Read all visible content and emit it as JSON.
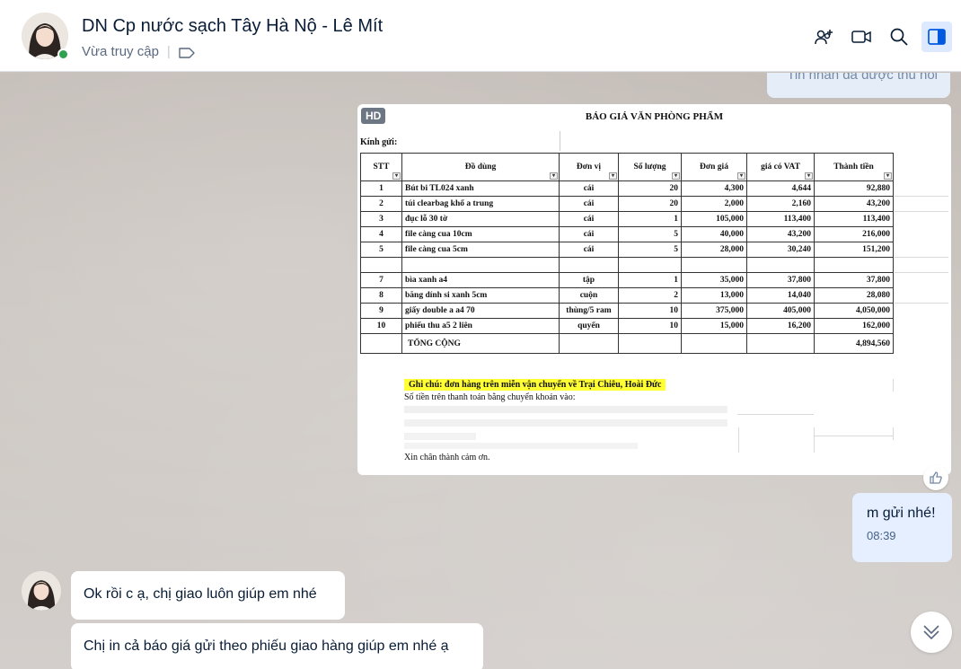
{
  "header": {
    "title": "DN Cp nước sạch Tây Hà Nộ - Lê Mít",
    "status": "Vừa truy cập",
    "separator": "|",
    "icons": [
      "add-member-icon",
      "video-call-icon",
      "search-icon",
      "sidebar-toggle-icon"
    ]
  },
  "messages": {
    "recalled": "Tin nhắn đã được thu hồi",
    "image": {
      "badge": "HD",
      "doc_title": "BÁO GIÁ VĂN PHÒNG PHẨM",
      "addressee": "Kính gửi:",
      "columns": [
        "STT",
        "Đồ dùng",
        "Đơn vị",
        "Số lượng",
        "Đơn giá",
        "giá có VAT",
        "Thành tiền"
      ],
      "rows": [
        [
          "1",
          "Bút bi TL024 xanh",
          "cái",
          "20",
          "4,300",
          "4,644",
          "92,880"
        ],
        [
          "2",
          "túi clearbag khổ a trung",
          "cái",
          "20",
          "2,000",
          "2,160",
          "43,200"
        ],
        [
          "3",
          "đục lỗ 30 tờ",
          "cái",
          "1",
          "105,000",
          "113,400",
          "113,400"
        ],
        [
          "4",
          "file càng cua 10cm",
          "cái",
          "5",
          "40,000",
          "43,200",
          "216,000"
        ],
        [
          "5",
          "file càng cua 5cm",
          "cái",
          "5",
          "28,000",
          "30,240",
          "151,200"
        ],
        [
          "",
          "",
          "",
          "",
          "",
          "",
          ""
        ],
        [
          "7",
          "bìa xanh a4",
          "tập",
          "1",
          "35,000",
          "37,800",
          "37,800"
        ],
        [
          "8",
          "băng dính si xanh 5cm",
          "cuộn",
          "2",
          "13,000",
          "14,040",
          "28,080"
        ],
        [
          "9",
          "giấy double a a4 70",
          "thùng/5 ram",
          "10",
          "375,000",
          "405,000",
          "4,050,000"
        ],
        [
          "10",
          "phiếu thu a5 2 liên",
          "quyển",
          "10",
          "15,000",
          "16,200",
          "162,000"
        ]
      ],
      "total_label": "TỔNG CỘNG",
      "total_value": "4,894,560",
      "note": "Ghi chú: đơn hàng trên miễn vận chuyển về Trại Chiêu, Hoài Đức",
      "payment": "Số tiền trên thanh toán bằng chuyển khoản vào:",
      "thanks": "Xin chân thành cảm ơn."
    },
    "sent": {
      "text": "m gửi nhé!",
      "time": "08:39"
    },
    "received": [
      "Ok rồi c ạ, chị giao luôn giúp em nhé",
      "Chị in cả báo giá gửi theo phiếu giao hàng giúp em nhé ạ"
    ]
  },
  "colors": {
    "online": "#30a14e",
    "sent_bubble": "#e5efff",
    "highlight": "#ffff33",
    "active_icon_bg": "#dce9ff"
  }
}
